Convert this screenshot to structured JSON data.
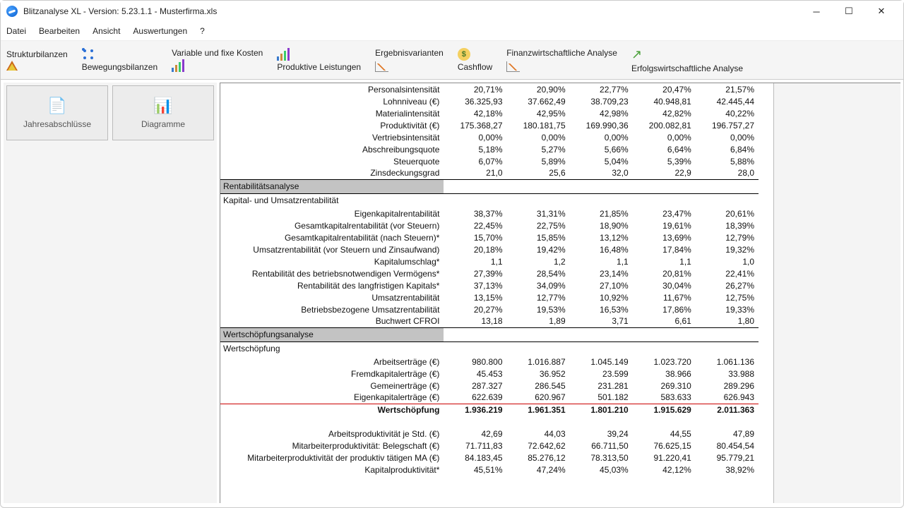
{
  "window": {
    "title": "Blitzanalyse XL - Version: 5.23.1.1 - Musterfirma.xls"
  },
  "menu": {
    "datei": "Datei",
    "bearbeiten": "Bearbeiten",
    "ansicht": "Ansicht",
    "auswertungen": "Auswertungen",
    "help": "?"
  },
  "toolbar": {
    "strukturbilanzen": "Strukturbilanzen",
    "bewegungsbilanzen": "Bewegungsbilanzen",
    "variable_fixe": "Variable und fixe Kosten",
    "produktive": "Produktive Leistungen",
    "ergebnisvarianten": "Ergebnisvarianten",
    "cashflow": "Cashflow",
    "finanz": "Finanzwirtschaftliche Analyse",
    "erfolg": "Erfolgswirtschaftliche Analyse"
  },
  "sidebar": {
    "jahresabschluesse": "Jahresabschlüsse",
    "diagramme": "Diagramme"
  },
  "top_rows": [
    {
      "label": "Personalsintensität",
      "v": [
        "20,71%",
        "20,90%",
        "22,77%",
        "20,47%",
        "21,57%"
      ]
    },
    {
      "label": "Lohnniveau (€)",
      "v": [
        "36.325,93",
        "37.662,49",
        "38.709,23",
        "40.948,81",
        "42.445,44"
      ]
    },
    {
      "label": "Materialintensität",
      "v": [
        "42,18%",
        "42,95%",
        "42,98%",
        "42,82%",
        "40,22%"
      ]
    },
    {
      "label": "Produktivität (€)",
      "v": [
        "175.368,27",
        "180.181,75",
        "169.990,36",
        "200.082,81",
        "196.757,27"
      ]
    },
    {
      "label": "Vertriebsintensität",
      "v": [
        "0,00%",
        "0,00%",
        "0,00%",
        "0,00%",
        "0,00%"
      ]
    },
    {
      "label": "Abschreibungsquote",
      "v": [
        "5,18%",
        "5,27%",
        "5,66%",
        "6,64%",
        "6,84%"
      ]
    },
    {
      "label": "Steuerquote",
      "v": [
        "6,07%",
        "5,89%",
        "5,04%",
        "5,39%",
        "5,88%"
      ]
    },
    {
      "label": "Zinsdeckungsgrad",
      "v": [
        "21,0",
        "25,6",
        "32,0",
        "22,9",
        "28,0"
      ]
    }
  ],
  "section1": {
    "title": "Rentabilitätsanalyse",
    "subhead": "Kapital- und Umsatzrentabilität",
    "rows": [
      {
        "label": "Eigenkapitalrentabilität",
        "v": [
          "38,37%",
          "31,31%",
          "21,85%",
          "23,47%",
          "20,61%"
        ]
      },
      {
        "label": "Gesamtkapitalrentabilität (vor Steuern)",
        "v": [
          "22,45%",
          "22,75%",
          "18,90%",
          "19,61%",
          "18,39%"
        ]
      },
      {
        "label": "Gesamtkapitalrentabilität (nach Steuern)*",
        "v": [
          "15,70%",
          "15,85%",
          "13,12%",
          "13,69%",
          "12,79%"
        ]
      },
      {
        "label": "Umsatzrentabilität (vor Steuern und Zinsaufwand)",
        "v": [
          "20,18%",
          "19,42%",
          "16,48%",
          "17,84%",
          "19,32%"
        ]
      },
      {
        "label": "Kapitalumschlag*",
        "v": [
          "1,1",
          "1,2",
          "1,1",
          "1,1",
          "1,0"
        ]
      },
      {
        "label": "Rentabilität des betriebsnotwendigen Vermögens*",
        "v": [
          "27,39%",
          "28,54%",
          "23,14%",
          "20,81%",
          "22,41%"
        ]
      },
      {
        "label": "Rentabilität des langfristigen Kapitals*",
        "v": [
          "37,13%",
          "34,09%",
          "27,10%",
          "30,04%",
          "26,27%"
        ]
      },
      {
        "label": "Umsatzrentabilität",
        "v": [
          "13,15%",
          "12,77%",
          "10,92%",
          "11,67%",
          "12,75%"
        ]
      },
      {
        "label": "Betriebsbezogene Umsatzrentabilität",
        "v": [
          "20,27%",
          "19,53%",
          "16,53%",
          "17,86%",
          "19,33%"
        ]
      },
      {
        "label": "Buchwert CFROI",
        "v": [
          "13,18",
          "1,89",
          "3,71",
          "6,61",
          "1,80"
        ]
      }
    ]
  },
  "section2": {
    "title": "Wertschöpfungsanalyse",
    "subhead": "Wertschöpfung",
    "rows": [
      {
        "label": "Arbeitserträge (€)",
        "v": [
          "980.800",
          "1.016.887",
          "1.045.149",
          "1.023.720",
          "1.061.136"
        ]
      },
      {
        "label": "Fremdkapitalerträge (€)",
        "v": [
          "45.453",
          "36.952",
          "23.599",
          "38.966",
          "33.988"
        ]
      },
      {
        "label": "Gemeinerträge (€)",
        "v": [
          "287.327",
          "286.545",
          "231.281",
          "269.310",
          "289.296"
        ]
      },
      {
        "label": "Eigenkapitalerträge (€)",
        "v": [
          "622.639",
          "620.967",
          "501.182",
          "583.633",
          "626.943"
        ],
        "redline": true
      }
    ],
    "total": {
      "label": "Wertschöpfung",
      "v": [
        "1.936.219",
        "1.961.351",
        "1.801.210",
        "1.915.629",
        "2.011.363"
      ]
    },
    "rows2": [
      {
        "label": "Arbeitsproduktivität je Std. (€)",
        "v": [
          "42,69",
          "44,03",
          "39,24",
          "44,55",
          "47,89"
        ]
      },
      {
        "label": "Mitarbeiterproduktivität: Belegschaft (€)",
        "v": [
          "71.711,83",
          "72.642,62",
          "66.711,50",
          "76.625,15",
          "80.454,54"
        ]
      },
      {
        "label": "Mitarbeiterproduktivität der produktiv tätigen MA (€)",
        "v": [
          "84.183,45",
          "85.276,12",
          "78.313,50",
          "91.220,41",
          "95.779,21"
        ]
      },
      {
        "label": "Kapitalproduktivität*",
        "v": [
          "45,51%",
          "47,24%",
          "45,03%",
          "42,12%",
          "38,92%"
        ]
      }
    ]
  }
}
